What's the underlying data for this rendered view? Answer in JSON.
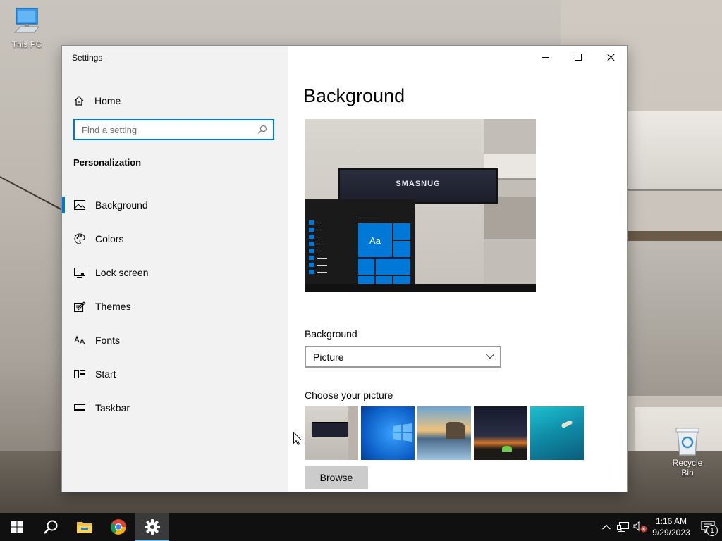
{
  "desktop": {
    "icons": [
      {
        "label": "This PC",
        "icon": "computer-icon"
      },
      {
        "label": "Recycle Bin",
        "icon": "recycle-bin-icon"
      }
    ]
  },
  "window": {
    "title": "Settings",
    "controls": [
      "minimize",
      "maximize",
      "close"
    ]
  },
  "sidebar": {
    "home_label": "Home",
    "search_placeholder": "Find a setting",
    "section_title": "Personalization",
    "items": [
      {
        "label": "Background",
        "icon": "picture-icon",
        "active": true
      },
      {
        "label": "Colors",
        "icon": "palette-icon",
        "active": false
      },
      {
        "label": "Lock screen",
        "icon": "lock-screen-icon",
        "active": false
      },
      {
        "label": "Themes",
        "icon": "themes-icon",
        "active": false
      },
      {
        "label": "Fonts",
        "icon": "fonts-icon",
        "active": false
      },
      {
        "label": "Start",
        "icon": "start-icon",
        "active": false
      },
      {
        "label": "Taskbar",
        "icon": "taskbar-icon",
        "active": false
      }
    ]
  },
  "main": {
    "title": "Background",
    "preview": {
      "tv_text": "SMASNUG",
      "tile_text": "Aa"
    },
    "background_label": "Background",
    "background_value": "Picture",
    "choose_label": "Choose your picture",
    "browse_label": "Browse"
  },
  "taskbar": {
    "apps": [
      "start-icon",
      "search-icon",
      "file-explorer-icon",
      "chrome-icon",
      "settings-icon"
    ],
    "time": "1:16 AM",
    "date": "9/29/2023",
    "notification_count": "1"
  },
  "colors": {
    "accent": "#0078d7",
    "sidebar_bg": "#f2f2f2",
    "taskbar_bg": "#101010"
  }
}
